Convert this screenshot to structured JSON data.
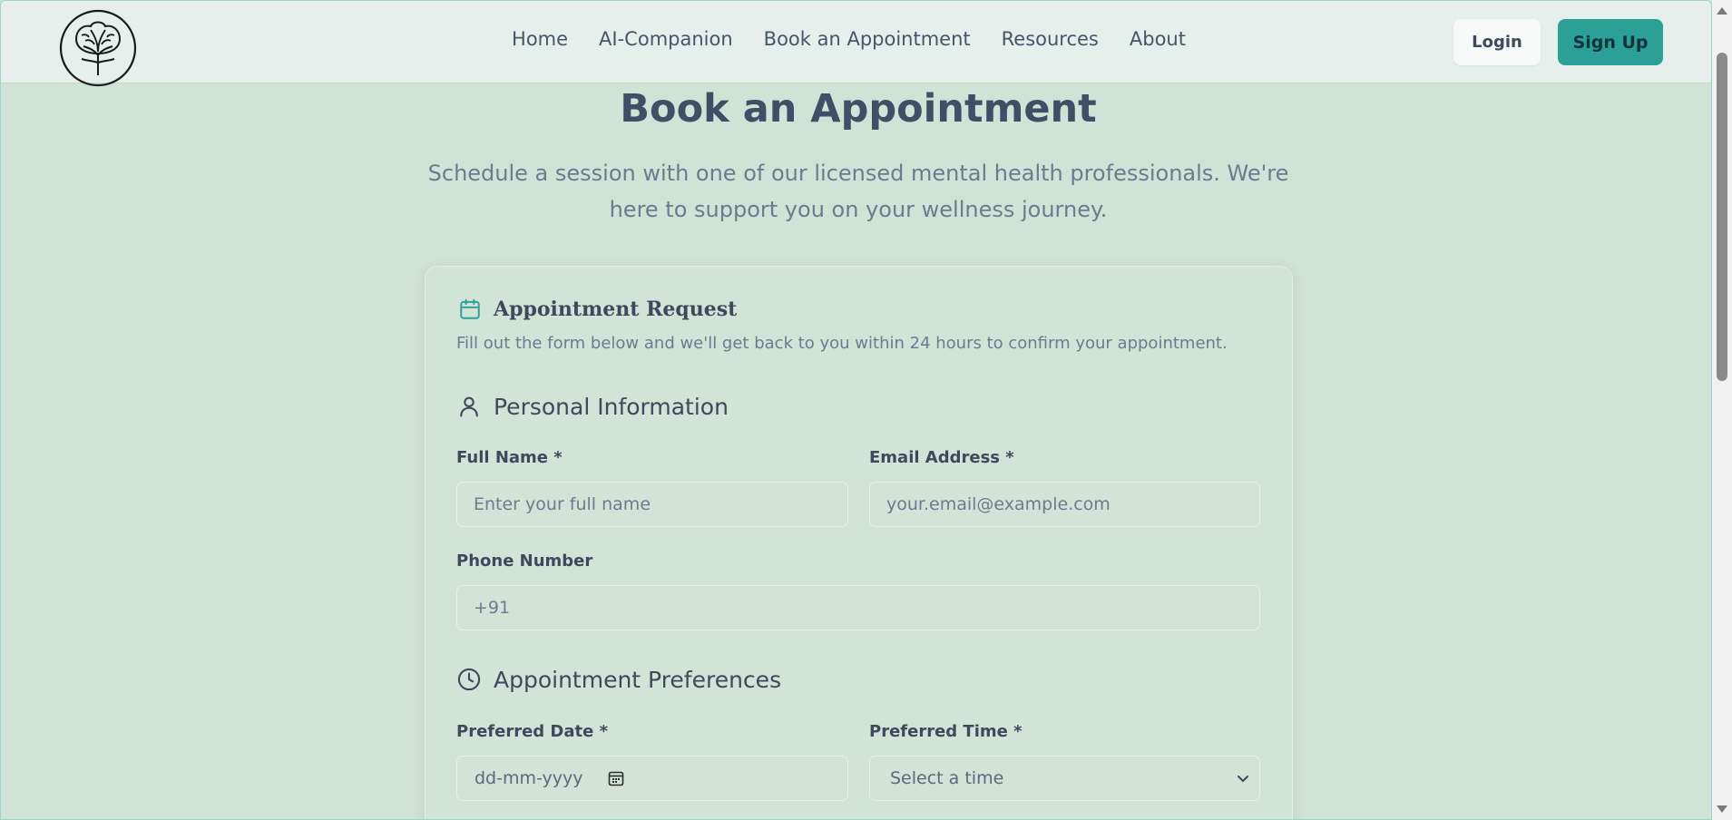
{
  "nav": {
    "links": [
      "Home",
      "AI-Companion",
      "Book an Appointment",
      "Resources",
      "About"
    ],
    "login_label": "Login",
    "signup_label": "Sign Up"
  },
  "hero": {
    "title": "Book an Appointment",
    "subtitle": "Schedule a session with one of our licensed mental health professionals. We're here to support you on your wellness journey."
  },
  "form": {
    "title": "Appointment Request",
    "description": "Fill out the form below and we'll get back to you within 24 hours to confirm your appointment.",
    "personal": {
      "heading": "Personal Information",
      "full_name_label": "Full Name *",
      "full_name_placeholder": "Enter your full name",
      "email_label": "Email Address *",
      "email_placeholder": "your.email@example.com",
      "phone_label": "Phone Number",
      "phone_placeholder": "+91"
    },
    "preferences": {
      "heading": "Appointment Preferences",
      "date_label": "Preferred Date *",
      "date_placeholder": "dd-mm-yyyy",
      "time_label": "Preferred Time *",
      "time_selected": "Select a time"
    }
  },
  "icons": {
    "logo": "tree-brain-logo-icon",
    "card": "calendar-icon",
    "personal": "user-icon",
    "preferences": "clock-icon",
    "date": "calendar-small-icon",
    "select": "chevron-down-icon"
  },
  "colors": {
    "page_bg": "#d0e3d7",
    "navbar_bg": "#e6efeb",
    "accent": "#2aa096",
    "text": "#3d4a5c",
    "muted": "#6b7c8f"
  }
}
